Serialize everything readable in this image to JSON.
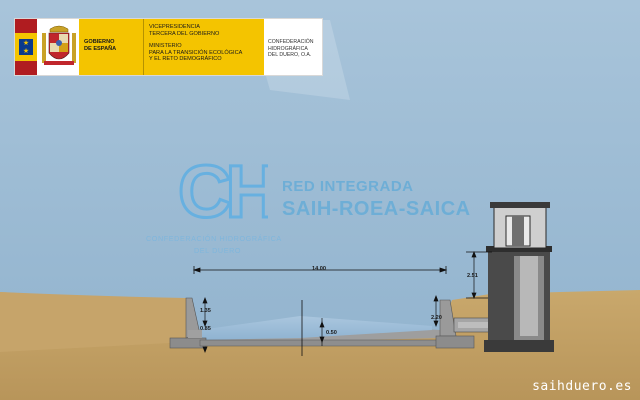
{
  "header": {
    "gov_line1": "GOBIERNO",
    "gov_line2": "DE ESPAÑA",
    "ministry_line1": "VICEPRESIDENCIA",
    "ministry_line2": "TERCERA DEL GOBIERNO",
    "ministry_line3": "MINISTERIO",
    "ministry_line4": "PARA LA TRANSICIÓN ECOLÓGICA",
    "ministry_line5": "Y EL RETO DEMOGRÁFICO",
    "conf_line1": "CONFEDERACIÓN",
    "conf_line2": "HIDROGRÁFICA",
    "conf_line3": "DEL DUERO, O.A."
  },
  "watermark": {
    "logo_text": "CHD",
    "title": "RED INTEGRADA",
    "subtitle": "SAIH-ROEA-SAICA",
    "org_line1": "CONFEDERACIÓN HIDROGRÁFICA",
    "org_line2": "DEL DUERO"
  },
  "dimensions": {
    "width": "14.00",
    "left_depth": "1.35",
    "left_base": "0.85",
    "center_depth": "0.50",
    "right_depth": "2.20",
    "tower_height": "2.51"
  },
  "footer": {
    "url": "saihduero.es"
  },
  "colors": {
    "sky": "#9dbcd5",
    "ground": "#c8a66a",
    "concrete": "#a7a7a7",
    "brand_yellow": "#f4c400",
    "brand_red": "#b01c20"
  }
}
